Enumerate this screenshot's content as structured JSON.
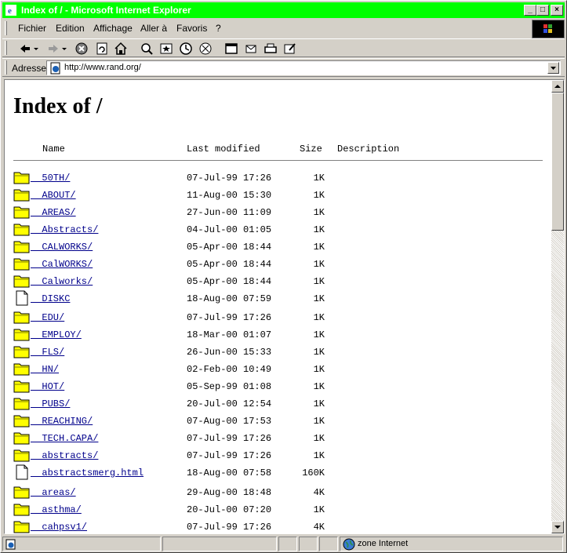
{
  "window": {
    "title": "Index of /  -  Microsoft Internet Explorer"
  },
  "menu": {
    "items": [
      "Fichier",
      "Edition",
      "Affichage",
      "Aller à",
      "Favoris",
      "?"
    ]
  },
  "address": {
    "label": "Adresse",
    "url": "http://www.rand.org/"
  },
  "page": {
    "heading": "Index of /",
    "columns": {
      "name": "Name",
      "last_modified": "Last modified",
      "size": "Size",
      "description": "Description"
    },
    "entries": [
      {
        "icon": "folder-icon",
        "name": "50TH/",
        "date": "07-Jul-99 17:26",
        "size": "1K"
      },
      {
        "icon": "folder-icon",
        "name": "ABOUT/",
        "date": "11-Aug-00 15:30",
        "size": "1K"
      },
      {
        "icon": "folder-icon",
        "name": "AREAS/",
        "date": "27-Jun-00 11:09",
        "size": "1K"
      },
      {
        "icon": "folder-icon",
        "name": "Abstracts/",
        "date": "04-Jul-00 01:05",
        "size": "1K"
      },
      {
        "icon": "folder-icon",
        "name": "CALWORKS/",
        "date": "05-Apr-00 18:44",
        "size": "1K"
      },
      {
        "icon": "folder-icon",
        "name": "CalWORKS/",
        "date": "05-Apr-00 18:44",
        "size": "1K"
      },
      {
        "icon": "folder-icon",
        "name": "Calworks/",
        "date": "05-Apr-00 18:44",
        "size": "1K"
      },
      {
        "icon": "file-icon",
        "name": "DISKC",
        "date": "18-Aug-00 07:59",
        "size": "1K"
      },
      {
        "icon": "folder-icon",
        "name": "EDU/",
        "date": "07-Jul-99 17:26",
        "size": "1K"
      },
      {
        "icon": "folder-icon",
        "name": "EMPLOY/",
        "date": "18-Mar-00 01:07",
        "size": "1K"
      },
      {
        "icon": "folder-icon",
        "name": "FLS/",
        "date": "26-Jun-00 15:33",
        "size": "1K"
      },
      {
        "icon": "folder-icon",
        "name": "HN/",
        "date": "02-Feb-00 10:49",
        "size": "1K"
      },
      {
        "icon": "folder-icon",
        "name": "HOT/",
        "date": "05-Sep-99 01:08",
        "size": "1K"
      },
      {
        "icon": "folder-icon",
        "name": "PUBS/",
        "date": "20-Jul-00 12:54",
        "size": "1K"
      },
      {
        "icon": "folder-icon",
        "name": "REACHING/",
        "date": "07-Aug-00 17:53",
        "size": "1K"
      },
      {
        "icon": "folder-icon",
        "name": "TECH.CAPA/",
        "date": "07-Jul-99 17:26",
        "size": "1K"
      },
      {
        "icon": "folder-icon",
        "name": "abstracts/",
        "date": "07-Jul-99 17:26",
        "size": "1K"
      },
      {
        "icon": "file-icon",
        "name": "abstractsmerg.html",
        "date": "18-Aug-00 07:58",
        "size": "160K"
      },
      {
        "icon": "folder-icon",
        "name": "areas/",
        "date": "29-Aug-00 18:48",
        "size": "4K"
      },
      {
        "icon": "folder-icon",
        "name": "asthma/",
        "date": "20-Jul-00 07:20",
        "size": "1K"
      },
      {
        "icon": "folder-icon",
        "name": "cahpsv1/",
        "date": "07-Jul-99 17:26",
        "size": "4K"
      }
    ]
  },
  "status": {
    "zone": "zone Internet"
  },
  "colors": {
    "titlebar": "#00ff00",
    "link": "#00008b",
    "folder": "#ffff00"
  }
}
